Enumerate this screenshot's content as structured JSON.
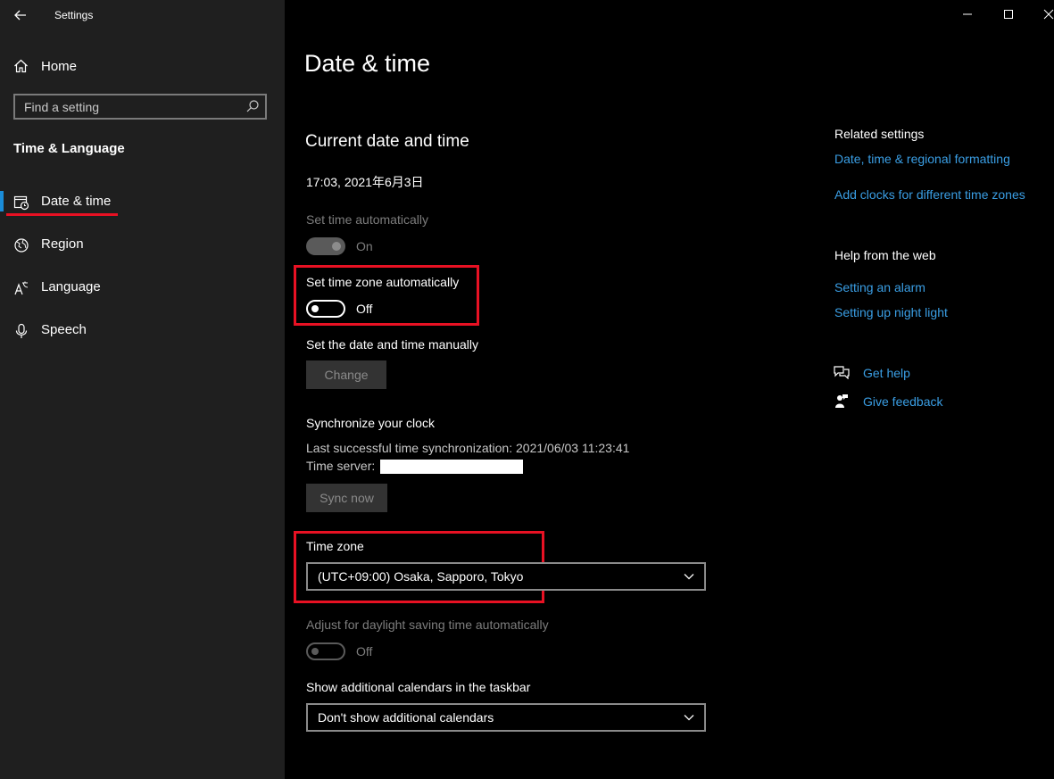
{
  "window": {
    "app_title": "Settings",
    "controls": {
      "minimize": "—",
      "maximize": "☐",
      "close": "✕"
    }
  },
  "sidebar": {
    "home_label": "Home",
    "search_placeholder": "Find a setting",
    "section_title": "Time & Language",
    "items": [
      {
        "label": "Date & time",
        "icon": "clock-calendar-icon",
        "selected": true
      },
      {
        "label": "Region",
        "icon": "globe-icon",
        "selected": false
      },
      {
        "label": "Language",
        "icon": "language-icon",
        "selected": false
      },
      {
        "label": "Speech",
        "icon": "microphone-icon",
        "selected": false
      }
    ]
  },
  "main": {
    "page_title": "Date & time",
    "section_title": "Current date and time",
    "current_datetime": "17:03, 2021年6月3日",
    "set_time_auto": {
      "label": "Set time automatically",
      "state": "On",
      "enabled": false
    },
    "set_timezone_auto": {
      "label": "Set time zone automatically",
      "state": "Off",
      "enabled": true
    },
    "manual": {
      "label": "Set the date and time manually",
      "button": "Change"
    },
    "sync": {
      "title": "Synchronize your clock",
      "last_sync": "Last successful time synchronization: 2021/06/03 11:23:41",
      "server_label": "Time server:",
      "button": "Sync now"
    },
    "timezone": {
      "label": "Time zone",
      "value": "(UTC+09:00) Osaka, Sapporo, Tokyo"
    },
    "dst": {
      "label": "Adjust for daylight saving time automatically",
      "state": "Off",
      "enabled": false
    },
    "calendars": {
      "label": "Show additional calendars in the taskbar",
      "value": "Don't show additional calendars"
    }
  },
  "related": {
    "title": "Related settings",
    "links": [
      "Date, time & regional formatting",
      "Add clocks for different time zones"
    ],
    "help_title": "Help from the web",
    "help_links": [
      "Setting an alarm",
      "Setting up night light"
    ],
    "get_help": "Get help",
    "give_feedback": "Give feedback"
  },
  "colors": {
    "accent": "#1a8cd8",
    "link": "#3a9ee4",
    "highlight": "#e81123",
    "sidebar_bg": "#1f1f1f",
    "main_bg": "#000000"
  }
}
